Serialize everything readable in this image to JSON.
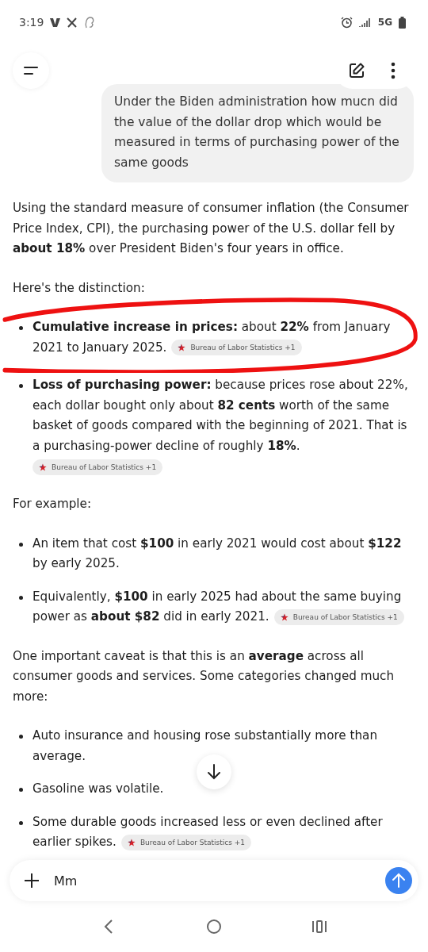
{
  "status_bar": {
    "time": "3:19",
    "network": "5G"
  },
  "user_message": "Under the Biden administration how mucn did the value of the dollar drop which would be measured in terms of purchasing power of the same goods",
  "answer": [
    {
      "kind": "paragraph",
      "text": "Using the standard measure of consumer inflation (the Consumer Price Index, CPI), the purchasing power of the U.S. dollar fell by **about 18%** over President Biden's four years in office."
    },
    {
      "kind": "paragraph",
      "text": "Here's the distinction:"
    },
    {
      "kind": "bullets",
      "annotated": true,
      "items": [
        {
          "text": "**Cumulative increase in prices:** about **22%** from January 2021 to January 2025.",
          "source": "Bureau of Labor Statistics +1"
        },
        {
          "text": "**Loss of purchasing power:** because prices rose about 22%, each dollar bought only about **82 cents** worth of the same basket of goods compared with the beginning of 2021. That is a purchasing-power decline of roughly **18%**.",
          "source": "Bureau of Labor Statistics +1",
          "source_block": true
        }
      ]
    },
    {
      "kind": "paragraph",
      "text": "For example:"
    },
    {
      "kind": "bullets",
      "items": [
        {
          "text": "An item that cost **$100** in early 2021 would cost about **$122** by early 2025."
        },
        {
          "text": "Equivalently, **$100** in early 2025 had about the same buying power as **about $82** did in early 2021.",
          "source": "Bureau of Labor Statistics +1"
        }
      ]
    },
    {
      "kind": "paragraph",
      "text": "One important caveat is that this is an **average** across all consumer goods and services. Some categories changed much more:"
    },
    {
      "kind": "bullets",
      "items": [
        {
          "text": "Auto insurance and housing rose substantially more than average."
        },
        {
          "text": "Gasoline was volatile."
        },
        {
          "text": "Some durable goods increased less or even declined after earlier spikes.",
          "source": "Bureau of Labor Statistics +1"
        }
      ]
    }
  ],
  "composer": {
    "value": "Mm"
  }
}
